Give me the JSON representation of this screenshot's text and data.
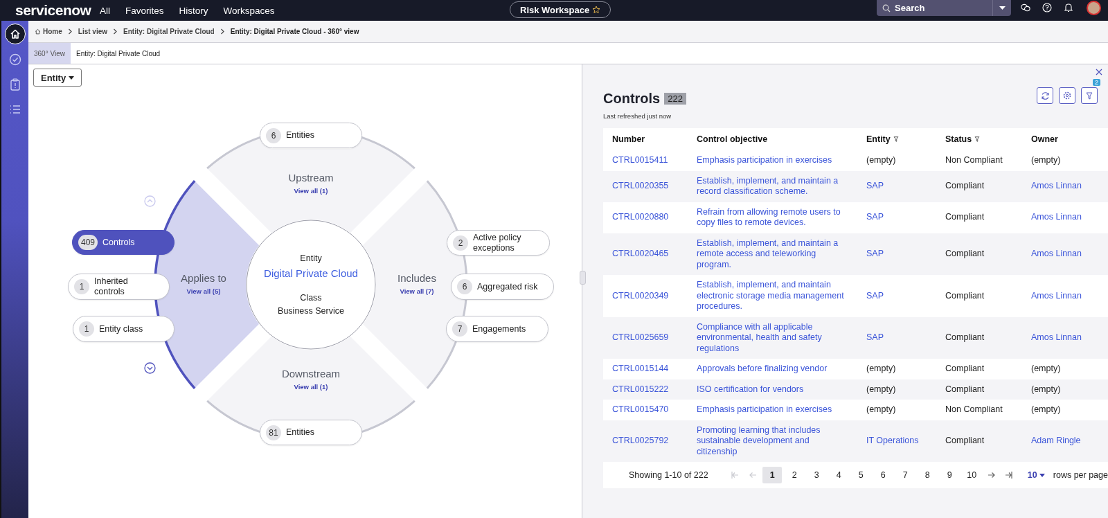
{
  "topbar": {
    "logo": "servicenow",
    "nav": [
      "All",
      "Favorites",
      "History",
      "Workspaces"
    ],
    "workspace": "Risk Workspace",
    "search": {
      "placeholder": "Search"
    }
  },
  "sidebar": {
    "items": [
      {
        "kind": "home",
        "selected": true
      },
      {
        "kind": "check",
        "selected": false
      },
      {
        "kind": "clipboard",
        "selected": false
      },
      {
        "kind": "list",
        "selected": false
      }
    ]
  },
  "breadcrumbs": [
    "Home",
    "List view",
    "Entity: Digital Private Cloud",
    "Entity: Digital Private Cloud - 360° view"
  ],
  "tabs": [
    {
      "label": "360° View",
      "selected": true
    },
    {
      "label": "Entity: Digital Private Cloud",
      "selected": false
    }
  ],
  "diagram": {
    "dropdown": "Entity",
    "center": {
      "label": "Entity",
      "name": "Digital Private Cloud",
      "class_label": "Class",
      "class_name": "Business Service"
    },
    "scroll_up": {
      "disabled": true
    },
    "scroll_down": {
      "disabled": false
    },
    "sectors": [
      {
        "title": "Upstream",
        "link": "View all (1)",
        "selected": false,
        "nodes": [
          {
            "count": "6",
            "label": "Entities",
            "selected": false
          }
        ]
      },
      {
        "title": "Applies to",
        "link": "View all (5)",
        "selected": true,
        "nodes": [
          {
            "count": "409",
            "label": "Controls",
            "selected": true
          },
          {
            "count": "1",
            "label": "Inherited controls",
            "selected": false
          },
          {
            "count": "1",
            "label": "Entity class",
            "selected": false
          }
        ]
      },
      {
        "title": "Includes",
        "link": "View all (7)",
        "selected": false,
        "nodes": [
          {
            "count": "2",
            "label": "Active policy exceptions",
            "selected": false
          },
          {
            "count": "6",
            "label": "Aggregated risk",
            "selected": false
          },
          {
            "count": "7",
            "label": "Engagements",
            "selected": false
          }
        ]
      },
      {
        "title": "Downstream",
        "link": "View all (1)",
        "selected": false,
        "nodes": [
          {
            "count": "81",
            "label": "Entities",
            "selected": false
          }
        ]
      }
    ]
  },
  "panel": {
    "title": "Controls",
    "count": "222",
    "subtitle": "Last refreshed just now",
    "filter_count": "2",
    "table": {
      "columns": [
        {
          "label": "Number",
          "filter": false
        },
        {
          "label": "Control objective",
          "filter": false
        },
        {
          "label": "Entity",
          "filter": true
        },
        {
          "label": "Status",
          "filter": true
        },
        {
          "label": "Owner",
          "filter": false
        }
      ],
      "rows": [
        {
          "cells": [
            {
              "text": "CTRL0015411",
              "link": true
            },
            {
              "text": "Emphasis participation in exercises",
              "link": true
            },
            {
              "text": "(empty)",
              "link": false
            },
            {
              "text": "Non Compliant",
              "link": false
            },
            {
              "text": "(empty)",
              "link": false
            }
          ]
        },
        {
          "cells": [
            {
              "text": "CTRL0020355",
              "link": true
            },
            {
              "text": "Establish, implement, and maintain a record classification scheme.",
              "link": true
            },
            {
              "text": "SAP",
              "link": true
            },
            {
              "text": "Compliant",
              "link": false
            },
            {
              "text": "Amos Linnan",
              "link": true
            }
          ]
        },
        {
          "cells": [
            {
              "text": "CTRL0020880",
              "link": true
            },
            {
              "text": "Refrain from allowing remote users to copy files to remote devices.",
              "link": true
            },
            {
              "text": "SAP",
              "link": true
            },
            {
              "text": "Compliant",
              "link": false
            },
            {
              "text": "Amos Linnan",
              "link": true
            }
          ]
        },
        {
          "cells": [
            {
              "text": "CTRL0020465",
              "link": true
            },
            {
              "text": "Establish, implement, and maintain a remote access and teleworking program.",
              "link": true
            },
            {
              "text": "SAP",
              "link": true
            },
            {
              "text": "Compliant",
              "link": false
            },
            {
              "text": "Amos Linnan",
              "link": true
            }
          ]
        },
        {
          "cells": [
            {
              "text": "CTRL0020349",
              "link": true
            },
            {
              "text": "Establish, implement, and maintain electronic storage media management procedures.",
              "link": true
            },
            {
              "text": "SAP",
              "link": true
            },
            {
              "text": "Compliant",
              "link": false
            },
            {
              "text": "Amos Linnan",
              "link": true
            }
          ]
        },
        {
          "cells": [
            {
              "text": "CTRL0025659",
              "link": true
            },
            {
              "text": "Compliance with all applicable environmental, health and safety regulations",
              "link": true
            },
            {
              "text": "SAP",
              "link": true
            },
            {
              "text": "Compliant",
              "link": false
            },
            {
              "text": "Amos Linnan",
              "link": true
            }
          ]
        },
        {
          "cells": [
            {
              "text": "CTRL0015144",
              "link": true
            },
            {
              "text": "Approvals before finalizing vendor",
              "link": true
            },
            {
              "text": "(empty)",
              "link": false
            },
            {
              "text": "Compliant",
              "link": false
            },
            {
              "text": "(empty)",
              "link": false
            }
          ]
        },
        {
          "cells": [
            {
              "text": "CTRL0015222",
              "link": true
            },
            {
              "text": "ISO certification for vendors",
              "link": true
            },
            {
              "text": "(empty)",
              "link": false
            },
            {
              "text": "Compliant",
              "link": false
            },
            {
              "text": "(empty)",
              "link": false
            }
          ]
        },
        {
          "cells": [
            {
              "text": "CTRL0015470",
              "link": true
            },
            {
              "text": "Emphasis participation in exercises",
              "link": true
            },
            {
              "text": "(empty)",
              "link": false
            },
            {
              "text": "Non Compliant",
              "link": false
            },
            {
              "text": "(empty)",
              "link": false
            }
          ]
        },
        {
          "cells": [
            {
              "text": "CTRL0025792",
              "link": true
            },
            {
              "text": "Promoting learning that includes sustainable development and citizenship",
              "link": true
            },
            {
              "text": "IT Operations",
              "link": true
            },
            {
              "text": "Compliant",
              "link": false
            },
            {
              "text": "Adam Ringle",
              "link": true
            }
          ]
        }
      ]
    },
    "pagination": {
      "summary": "Showing 1-10 of 222",
      "first": {
        "disabled": true
      },
      "prev": {
        "disabled": true
      },
      "next": {
        "disabled": false
      },
      "last": {
        "disabled": false
      },
      "pages": [
        {
          "label": "1",
          "selected": true
        },
        {
          "label": "2",
          "selected": false
        },
        {
          "label": "3",
          "selected": false
        },
        {
          "label": "4",
          "selected": false
        },
        {
          "label": "5",
          "selected": false
        },
        {
          "label": "6",
          "selected": false
        },
        {
          "label": "7",
          "selected": false
        },
        {
          "label": "8",
          "selected": false
        },
        {
          "label": "9",
          "selected": false
        },
        {
          "label": "10",
          "selected": false
        }
      ],
      "rows_per_page": "10",
      "rows_label": "rows per page"
    }
  }
}
